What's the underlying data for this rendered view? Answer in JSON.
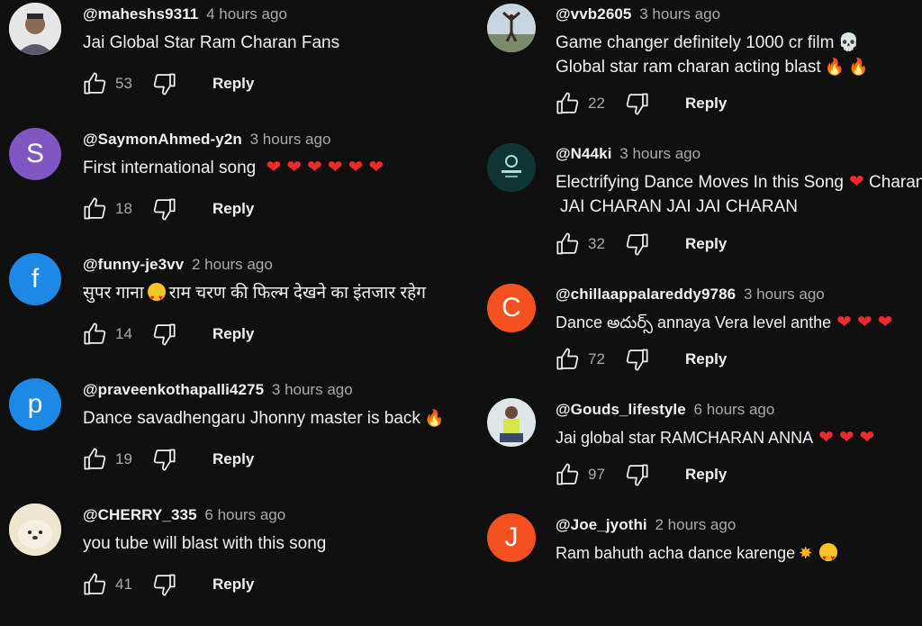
{
  "left_comments": [
    {
      "handle": "@maheshs9311",
      "time": "4 hours ago",
      "text": "Jai Global Star Ram Charan Fans",
      "likes": "53",
      "reply": "Reply"
    },
    {
      "handle": "@SaymonAhmed-y2n",
      "time": "3 hours ago",
      "text": "First international song",
      "likes": "18",
      "reply": "Reply",
      "avatar_letter": "S"
    },
    {
      "handle": "@funny-je3vv",
      "time": "2 hours ago",
      "text_a": "सुपर गाना",
      "text_b": "राम चरण की फिल्म देखने का इंतजार रहेग",
      "likes": "14",
      "reply": "Reply",
      "avatar_letter": "f"
    },
    {
      "handle": "@praveenkothapalli4275",
      "time": "3 hours ago",
      "text": "Dance savadhengaru Jhonny master is back",
      "likes": "19",
      "reply": "Reply",
      "avatar_letter": "p"
    },
    {
      "handle": "@CHERRY_335",
      "time": "6 hours ago",
      "text": "you tube will blast with this song",
      "likes": "41",
      "reply": "Reply"
    }
  ],
  "right_comments": [
    {
      "handle": "@vvb2605",
      "time": "3 hours ago",
      "line1": "Game changer definitely 1000 cr film",
      "line2": "Global star ram charan acting blast",
      "likes": "22",
      "reply": "Reply"
    },
    {
      "handle": "@N44ki",
      "time": "3 hours ago",
      "line1": "Electrifying Dance Moves In this Song",
      "line1_tail": "Charan",
      "line2": "JAI CHARAN JAI JAI CHARAN",
      "likes": "32",
      "reply": "Reply"
    },
    {
      "handle": "@chillaappalareddy9786",
      "time": "3 hours ago",
      "text": "Dance అదుర్స్ annaya Vera level anthe",
      "likes": "72",
      "reply": "Reply",
      "avatar_letter": "C"
    },
    {
      "handle": "@Gouds_lifestyle",
      "time": "6 hours ago",
      "text": "Jai global star RAMCHARAN ANNA",
      "likes": "97",
      "reply": "Reply"
    },
    {
      "handle": "@Joe_jyothi",
      "time": "2 hours ago",
      "text": "Ram bahuth acha dance karenge",
      "avatar_letter": "J"
    }
  ],
  "colors": {
    "background": "#0f0f0f",
    "text": "#f1f1f1",
    "muted": "#aaaaaa",
    "purple": "#7e57c2",
    "blue": "#1e88e5",
    "orange": "#f4511e",
    "heart": "#ee2b2b"
  }
}
